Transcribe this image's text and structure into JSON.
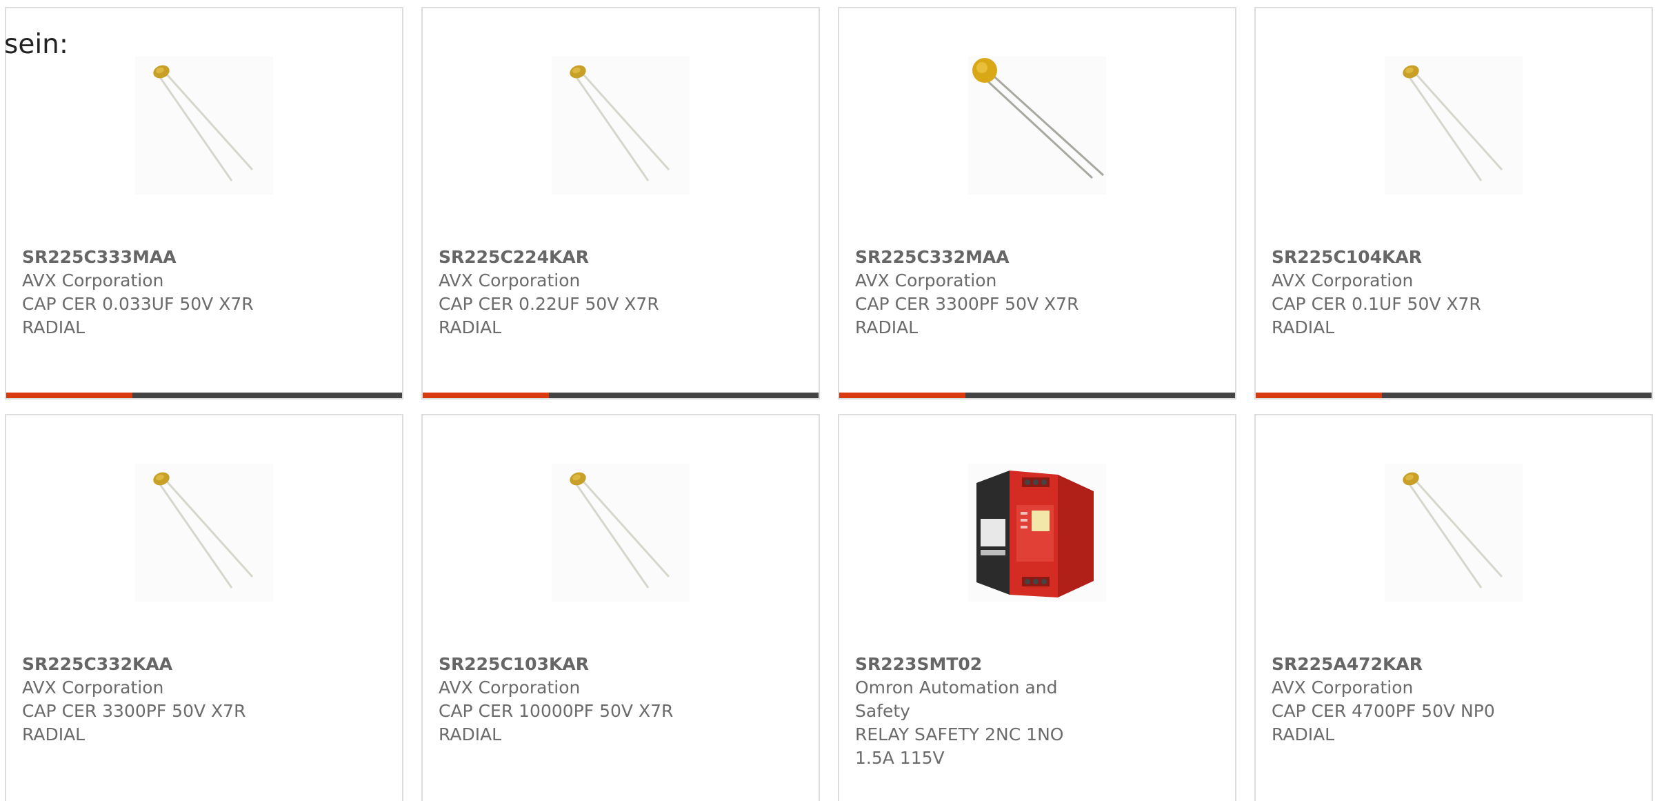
{
  "heading": "sein:",
  "colors": {
    "accent": "#d93a0f",
    "bar": "#444444",
    "border": "#dddddd",
    "text": "#6b6b6b"
  },
  "products": [
    {
      "part_number": "SR225C333MAA",
      "manufacturer": "AVX Corporation",
      "description": "CAP CER 0.033UF 50V X7R RADIAL",
      "image_icon": "ceramic-capacitor-icon"
    },
    {
      "part_number": "SR225C224KAR",
      "manufacturer": "AVX Corporation",
      "description": "CAP CER 0.22UF 50V X7R RADIAL",
      "image_icon": "ceramic-capacitor-icon"
    },
    {
      "part_number": "SR225C332MAA",
      "manufacturer": "AVX Corporation",
      "description": "CAP CER 3300PF 50V X7R RADIAL",
      "image_icon": "ceramic-capacitor-icon"
    },
    {
      "part_number": "SR225C104KAR",
      "manufacturer": "AVX Corporation",
      "description": "CAP CER 0.1UF 50V X7R RADIAL",
      "image_icon": "ceramic-capacitor-icon"
    },
    {
      "part_number": "SR225C332KAA",
      "manufacturer": "AVX Corporation",
      "description": "CAP CER 3300PF 50V X7R RADIAL",
      "image_icon": "ceramic-capacitor-icon"
    },
    {
      "part_number": "SR225C103KAR",
      "manufacturer": "AVX Corporation",
      "description": "CAP CER 10000PF 50V X7R RADIAL",
      "image_icon": "ceramic-capacitor-icon"
    },
    {
      "part_number": "SR223SMT02",
      "manufacturer": "Omron Automation and Safety",
      "description": "RELAY SAFETY 2NC 1NO 1.5A 115V",
      "image_icon": "safety-relay-icon"
    },
    {
      "part_number": "SR225A472KAR",
      "manufacturer": "AVX Corporation",
      "description": "CAP CER 4700PF 50V NP0 RADIAL",
      "image_icon": "ceramic-capacitor-icon"
    }
  ]
}
